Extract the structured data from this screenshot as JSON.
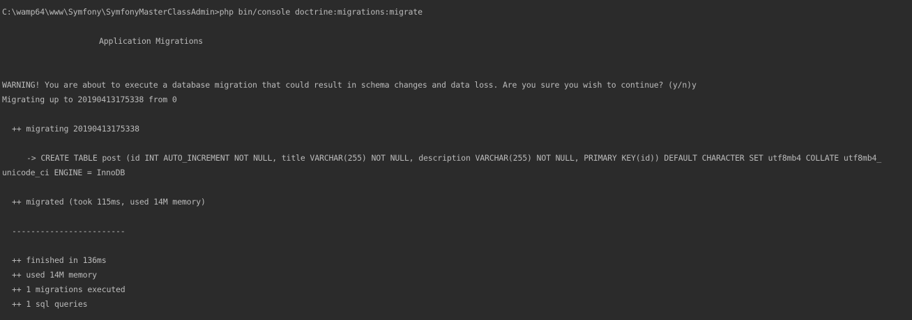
{
  "terminal": {
    "prompt": "C:\\wamp64\\www\\Symfony\\SymfonyMasterClassAdmin>php bin/console doctrine:migrations:migrate",
    "section_title": "Application Migrations",
    "warning": "WARNING! You are about to execute a database migration that could result in schema changes and data loss. Are you sure you wish to continue? (y/n)y",
    "migrating_up": "Migrating up to 20190413175338 from 0",
    "migrating_version": "++ migrating 20190413175338",
    "sql_line_1": "-> CREATE TABLE post (id INT AUTO_INCREMENT NOT NULL, title VARCHAR(255) NOT NULL, description VARCHAR(255) NOT NULL, PRIMARY KEY(id)) DEFAULT CHARACTER SET utf8mb4 COLLATE utf8mb4_",
    "sql_line_2": "unicode_ci ENGINE = InnoDB",
    "migrated": "++ migrated (took 115ms, used 14M memory)",
    "separator": "------------------------",
    "finished": "++ finished in 136ms",
    "memory": "++ used 14M memory",
    "migrations_executed": "++ 1 migrations executed",
    "sql_queries": "++ 1 sql queries"
  }
}
